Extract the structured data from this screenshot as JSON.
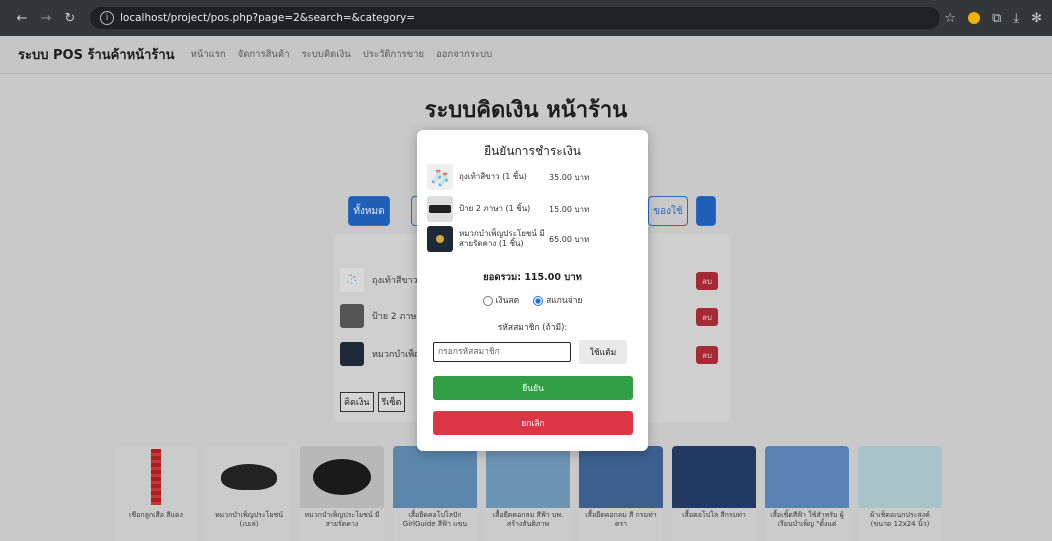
{
  "browser": {
    "url": "localhost/project/pos.php?page=2&search=&category="
  },
  "nav": {
    "brand": "ระบบ POS ร้านค้าหน้าร้าน",
    "links": [
      "หน้าแรก",
      "จัดการสินค้า",
      "ระบบคิดเงิน",
      "ประวัติการขาย",
      "ออกจากระบบ"
    ]
  },
  "page": {
    "title": "ระบบคิดเงิน หน้าร้าน",
    "category_buttons": [
      "ทั้งหมด",
      "ของใช้"
    ]
  },
  "cart": {
    "items": [
      {
        "name": "ถุงเท้าสีขาว",
        "delete": "ลบ"
      },
      {
        "name": "ป้าย 2 ภาษา",
        "delete": "ลบ"
      },
      {
        "name": "หมวกบำเพ็ญ",
        "delete": "ลบ"
      }
    ],
    "actions": [
      "คิดเงิน",
      "รีเซ็ต"
    ]
  },
  "products": [
    {
      "name": "เชือกลูกเสือ สีแดง"
    },
    {
      "name": "หมวกบำเพ็ญประโยชน์ (เบเล่)"
    },
    {
      "name": "หมวกบำเพ็ญประโยชน์ มีสายรัดคาง"
    },
    {
      "name": "เสื้อยืดคอโปโลปัก GirlGuide สีฟ้า แขน"
    },
    {
      "name": "เสื้อยืดคอกลม สีฟ้า บพ. สร้างสันติภาพ"
    },
    {
      "name": "เสื้อยืดคอกลม สี กรมท่า ตรา"
    },
    {
      "name": "เสื้อคอโปโล สีกรมท่า"
    },
    {
      "name": "เสื้อเชิ้ตสีฟ้า ใช้สำหรับ ผู้เรียนบำเพ็ญ \"ตั้งแต่"
    },
    {
      "name": "ผ้าเช็ดอเนกประสงค์ (ขนาด 12x24 นิ้ว)"
    }
  ],
  "modal": {
    "title": "ยืนยันการชำระเงิน",
    "items": [
      {
        "name": "ถุงเท้าสีขาว (1 ชิ้น)",
        "price": "35.00 บาท"
      },
      {
        "name": "ป้าย 2 ภาษา (1 ชิ้น)",
        "price": "15.00 บาท"
      },
      {
        "name": "หมวกบำเพ็ญประโยชน์ มีสายรัดคาง (1 ชิ้น)",
        "price": "65.00 บาท"
      }
    ],
    "total": "ยอดรวม: 115.00 บาท",
    "payment_cash": "เงินสด",
    "payment_scan": "สแกนจ่าย",
    "member_label": "รหัสสมาชิก (ถ้ามี):",
    "member_placeholder": "กรอกรหัสสมาชิก",
    "use_button": "ใช้แต้ม",
    "confirm_button": "ยืนยัน",
    "cancel_button": "ยกเลิก"
  }
}
